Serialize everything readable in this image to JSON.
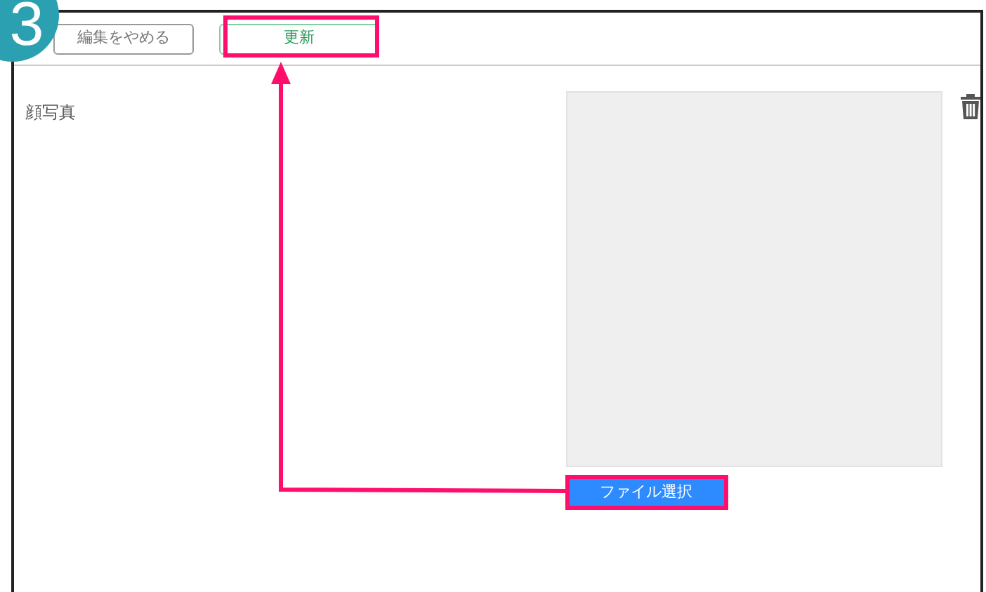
{
  "step_badge": "3",
  "toolbar": {
    "buttons": [
      {
        "label": "編集をやめる",
        "kind": "cancel"
      },
      {
        "label": "更新",
        "kind": "primary"
      }
    ]
  },
  "field": {
    "label": "顔写真",
    "file_button": {
      "label": "ファイル選択"
    }
  }
}
